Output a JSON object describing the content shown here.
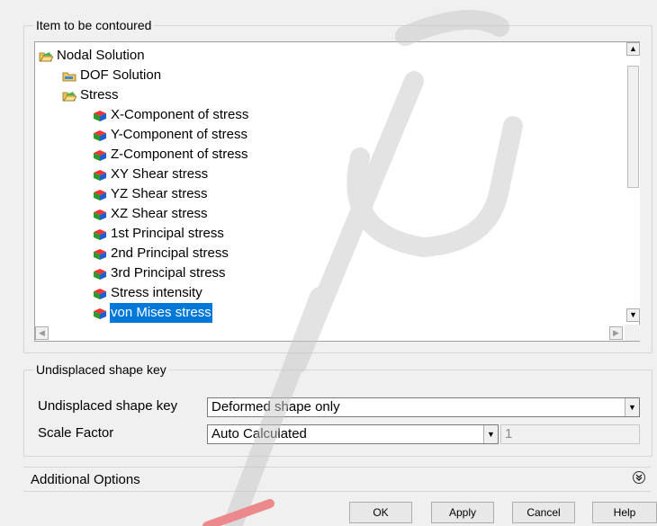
{
  "contour_group": {
    "title": "Item to be contoured",
    "tree": {
      "nodes": [
        {
          "label": "Nodal Solution",
          "icon": "folder-open-icon",
          "level": 0,
          "selected": false
        },
        {
          "label": "DOF Solution",
          "icon": "folder-closed-icon",
          "level": 1,
          "selected": false
        },
        {
          "label": "Stress",
          "icon": "folder-open-icon",
          "level": 1,
          "selected": false
        },
        {
          "label": "X-Component of stress",
          "icon": "cube-icon",
          "level": 2,
          "selected": false
        },
        {
          "label": "Y-Component of stress",
          "icon": "cube-icon",
          "level": 2,
          "selected": false
        },
        {
          "label": "Z-Component of stress",
          "icon": "cube-icon",
          "level": 2,
          "selected": false
        },
        {
          "label": "XY Shear stress",
          "icon": "cube-icon",
          "level": 2,
          "selected": false
        },
        {
          "label": "YZ Shear stress",
          "icon": "cube-icon",
          "level": 2,
          "selected": false
        },
        {
          "label": "XZ Shear stress",
          "icon": "cube-icon",
          "level": 2,
          "selected": false
        },
        {
          "label": "1st Principal stress",
          "icon": "cube-icon",
          "level": 2,
          "selected": false
        },
        {
          "label": "2nd Principal stress",
          "icon": "cube-icon",
          "level": 2,
          "selected": false
        },
        {
          "label": "3rd Principal stress",
          "icon": "cube-icon",
          "level": 2,
          "selected": false
        },
        {
          "label": "Stress intensity",
          "icon": "cube-icon",
          "level": 2,
          "selected": false
        },
        {
          "label": "von Mises stress",
          "icon": "cube-icon",
          "level": 2,
          "selected": true
        }
      ]
    }
  },
  "shape_group": {
    "title": "Undisplaced shape key",
    "shape_key_label": "Undisplaced shape key",
    "shape_key_value": "Deformed shape only",
    "scale_factor_label": "Scale Factor",
    "scale_factor_value": "Auto Calculated",
    "scale_factor_number": "1"
  },
  "additional_options": {
    "label": "Additional Options",
    "icon": "double-chevron-down-icon"
  },
  "buttons": {
    "ok": "OK",
    "apply": "Apply",
    "cancel": "Cancel",
    "help": "Help"
  },
  "colors": {
    "selection": "#0078d7",
    "watermark_red": "#e8242b"
  }
}
